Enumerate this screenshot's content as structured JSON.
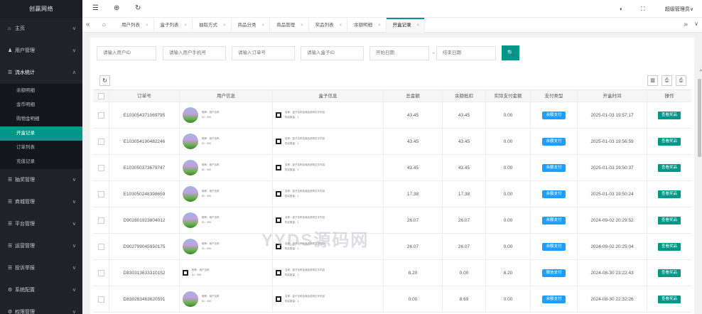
{
  "sidebar": {
    "brand": "创赢网络",
    "items": [
      {
        "label": "主页",
        "icon": "home-icon",
        "glyph": "⌂"
      },
      {
        "label": "用户管理",
        "icon": "user-icon",
        "glyph": "♟"
      },
      {
        "label": "流水统计",
        "icon": "list-icon",
        "glyph": "☰"
      }
    ],
    "sub_items": [
      "余额明细",
      "金币明细",
      "购物金明细",
      "开盒记录",
      "订单列表",
      "充值记录"
    ],
    "items_after": [
      {
        "label": "抽奖管理",
        "icon": "list-icon",
        "glyph": "☰"
      },
      {
        "label": "商城管理",
        "icon": "list-icon",
        "glyph": "☰"
      },
      {
        "label": "平台管理",
        "icon": "list-icon",
        "glyph": "☰"
      },
      {
        "label": "运营管理",
        "icon": "list-icon",
        "glyph": "☰"
      },
      {
        "label": "投诉举报",
        "icon": "list-icon",
        "glyph": "☰"
      },
      {
        "label": "系统配置",
        "icon": "gear-icon",
        "glyph": "⚙"
      },
      {
        "label": "权限管理",
        "icon": "gear-icon",
        "glyph": "⚙"
      }
    ]
  },
  "header": {
    "menu_glyph": "☰",
    "globe_glyph": "⊕",
    "refresh_glyph": "↻",
    "theme_glyph": "◐",
    "fullscreen_glyph": "⛶",
    "admin": "超级管理员∨"
  },
  "tabsbar": {
    "prev": "«",
    "home_glyph": "⌂",
    "next": "»",
    "down": "∨",
    "close_glyph": "×",
    "tabs": [
      "用户列表",
      "盒子列表",
      "抽取方式",
      "商品分类",
      "商品管理",
      "奖品列表",
      "余额明细",
      "开盒记录"
    ]
  },
  "filters": {
    "user_id": "请输入用户ID",
    "phone": "请输入用户手机号",
    "order_no": "请输入订单号",
    "box_id": "请输入盒子ID",
    "start_date": "开始日期",
    "dash": "-",
    "end_date": "结束日期",
    "search_glyph": "🔍"
  },
  "toolbar": {
    "refresh_glyph": "↻",
    "columns_glyph": "▥",
    "export_glyph": "⎙",
    "print_glyph": "⎙"
  },
  "table": {
    "columns": [
      "订单号",
      "用户信息",
      "盒子信息",
      "总金额",
      "余额抵扣",
      "实际支付金额",
      "支付类型",
      "开盒时间",
      "操作"
    ],
    "user_lines": [
      "昵称：用户名称",
      "ID：000"
    ],
    "box_lines": [
      "名称：盒子名称及商品说明文字内容",
      "购买数量：1"
    ],
    "rows": [
      {
        "order": "E103054371069795",
        "total": "43.45",
        "balance": "43.45",
        "paid": "0.00",
        "pay_type": "余额支付",
        "time": "2025-01-03 19:57:17",
        "action": "查看奖品"
      },
      {
        "order": "E103054190482246",
        "total": "43.45",
        "balance": "43.45",
        "paid": "0.00",
        "pay_type": "余额支付",
        "time": "2025-01-03 19:56:59",
        "action": "查看奖品"
      },
      {
        "order": "E103050373679747",
        "total": "43.45",
        "balance": "43.45",
        "paid": "0.00",
        "pay_type": "余额支付",
        "time": "2025-01-03 19:50:37",
        "action": "查看奖品"
      },
      {
        "order": "E103050248398659",
        "total": "17.38",
        "balance": "17.38",
        "paid": "0.00",
        "pay_type": "余额支付",
        "time": "2025-01-03 19:50:24",
        "action": "查看奖品"
      },
      {
        "order": "D902801923804012",
        "total": "26.07",
        "balance": "26.07",
        "paid": "0.00",
        "pay_type": "余额支付",
        "time": "2024-09-02 20:29:52",
        "action": "查看奖品"
      },
      {
        "order": "D902799045950175",
        "total": "26.07",
        "balance": "26.07",
        "paid": "0.00",
        "pay_type": "余额支付",
        "time": "2024-09-02 20:25:04",
        "action": "查看奖品"
      },
      {
        "order": "D830313633310152",
        "total": "8.20",
        "balance": "0.00",
        "paid": "8.20",
        "pay_type": "微信支付",
        "time": "2024-08-30 23:22:43",
        "action": "查看奖品"
      },
      {
        "order": "D830283463620591",
        "total": "0.00",
        "balance": "8.69",
        "paid": "0.00",
        "pay_type": "余额支付",
        "time": "2024-08-30 22:32:26",
        "action": "查看奖品"
      }
    ]
  },
  "watermark": "YYDS源码网",
  "scroll_up": "^"
}
